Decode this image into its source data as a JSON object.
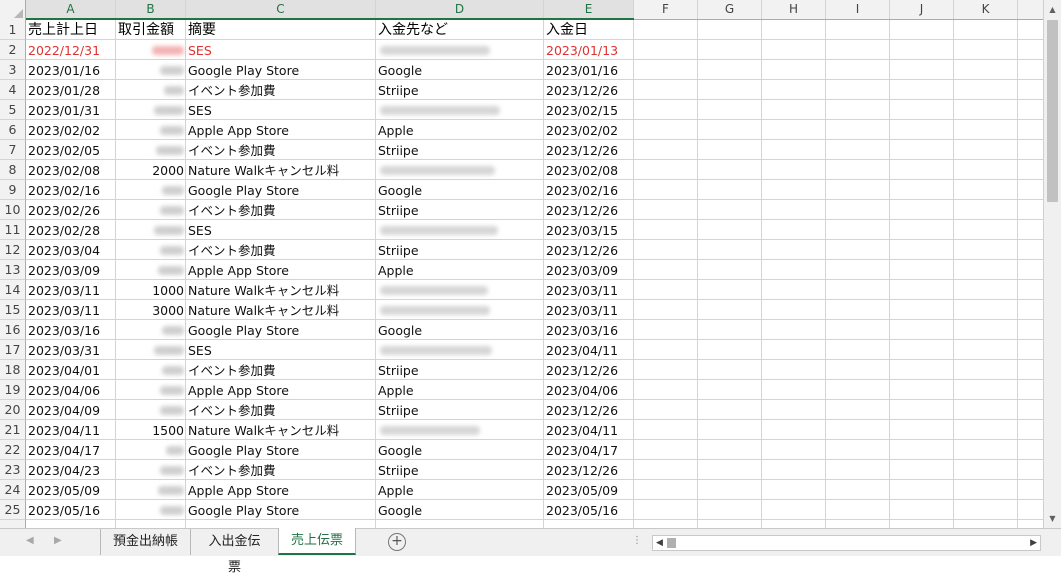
{
  "columns": [
    "A",
    "B",
    "C",
    "D",
    "E",
    "F",
    "G",
    "H",
    "I",
    "J",
    "K"
  ],
  "selected_columns": [
    "A",
    "B",
    "C",
    "D",
    "E"
  ],
  "header_row": {
    "row_number": "1",
    "a": "売上計上日",
    "b": "取引金額",
    "c": "摘要",
    "d": "入金先など",
    "e": "入金日"
  },
  "rows": [
    {
      "n": "2",
      "a": "2022/12/31",
      "b": "",
      "c": "SES",
      "d": "",
      "e": "2023/01/13",
      "red": true,
      "b_blur": true,
      "d_blur": true
    },
    {
      "n": "3",
      "a": "2023/01/16",
      "b": "",
      "c": "Google Play Store",
      "d": "Google",
      "e": "2023/01/16",
      "b_blur": true
    },
    {
      "n": "4",
      "a": "2023/01/28",
      "b": "",
      "c": "イベント参加費",
      "d": "Striipe",
      "e": "2023/12/26",
      "b_blur": true
    },
    {
      "n": "5",
      "a": "2023/01/31",
      "b": "",
      "c": "SES",
      "d": "",
      "e": "2023/02/15",
      "b_blur": true,
      "d_blur": true
    },
    {
      "n": "6",
      "a": "2023/02/02",
      "b": "",
      "c": "Apple App Store",
      "d": "Apple",
      "e": "2023/02/02",
      "b_blur": true
    },
    {
      "n": "7",
      "a": "2023/02/05",
      "b": "",
      "c": "イベント参加費",
      "d": "Striipe",
      "e": "2023/12/26",
      "b_blur": true
    },
    {
      "n": "8",
      "a": "2023/02/08",
      "b": "2000",
      "c": "Nature Walkキャンセル料",
      "d": "",
      "e": "2023/02/08",
      "d_blur": true
    },
    {
      "n": "9",
      "a": "2023/02/16",
      "b": "",
      "c": "Google Play Store",
      "d": "Google",
      "e": "2023/02/16",
      "b_blur": true
    },
    {
      "n": "10",
      "a": "2023/02/26",
      "b": "",
      "c": "イベント参加費",
      "d": "Striipe",
      "e": "2023/12/26",
      "b_blur": true
    },
    {
      "n": "11",
      "a": "2023/02/28",
      "b": "",
      "c": "SES",
      "d": "",
      "e": "2023/03/15",
      "b_blur": true,
      "d_blur": true
    },
    {
      "n": "12",
      "a": "2023/03/04",
      "b": "",
      "c": "イベント参加費",
      "d": "Striipe",
      "e": "2023/12/26",
      "b_blur": true
    },
    {
      "n": "13",
      "a": "2023/03/09",
      "b": "",
      "c": "Apple App Store",
      "d": "Apple",
      "e": "2023/03/09",
      "b_blur": true
    },
    {
      "n": "14",
      "a": "2023/03/11",
      "b": "1000",
      "c": "Nature Walkキャンセル料",
      "d": "",
      "e": "2023/03/11",
      "d_blur": true
    },
    {
      "n": "15",
      "a": "2023/03/11",
      "b": "3000",
      "c": "Nature Walkキャンセル料",
      "d": "",
      "e": "2023/03/11",
      "d_blur": true
    },
    {
      "n": "16",
      "a": "2023/03/16",
      "b": "",
      "c": "Google Play Store",
      "d": "Google",
      "e": "2023/03/16",
      "b_blur": true
    },
    {
      "n": "17",
      "a": "2023/03/31",
      "b": "",
      "c": "SES",
      "d": "",
      "e": "2023/04/11",
      "b_blur": true,
      "d_blur": true
    },
    {
      "n": "18",
      "a": "2023/04/01",
      "b": "",
      "c": "イベント参加費",
      "d": "Striipe",
      "e": "2023/12/26",
      "b_blur": true
    },
    {
      "n": "19",
      "a": "2023/04/06",
      "b": "",
      "c": "Apple App Store",
      "d": "Apple",
      "e": "2023/04/06",
      "b_blur": true
    },
    {
      "n": "20",
      "a": "2023/04/09",
      "b": "",
      "c": "イベント参加費",
      "d": "Striipe",
      "e": "2023/12/26",
      "b_blur": true
    },
    {
      "n": "21",
      "a": "2023/04/11",
      "b": "1500",
      "c": "Nature Walkキャンセル料",
      "d": "",
      "e": "2023/04/11",
      "d_blur": true
    },
    {
      "n": "22",
      "a": "2023/04/17",
      "b": "",
      "c": "Google Play Store",
      "d": "Google",
      "e": "2023/04/17",
      "b_blur": true
    },
    {
      "n": "23",
      "a": "2023/04/23",
      "b": "",
      "c": "イベント参加費",
      "d": "Striipe",
      "e": "2023/12/26",
      "b_blur": true
    },
    {
      "n": "24",
      "a": "2023/05/09",
      "b": "",
      "c": "Apple App Store",
      "d": "Apple",
      "e": "2023/05/09",
      "b_blur": true
    },
    {
      "n": "25",
      "a": "2023/05/16",
      "b": "",
      "c": "Google Play Store",
      "d": "Google",
      "e": "2023/05/16",
      "b_blur": true
    }
  ],
  "sheet_tabs": [
    {
      "label": "預金出納帳",
      "active": false
    },
    {
      "label": "入出金伝票",
      "active": false
    },
    {
      "label": "売上伝票",
      "active": true
    }
  ],
  "icons": {
    "nav_prev": "nav-prev-icon",
    "nav_next": "nav-next-icon",
    "add_sheet": "plus-circle-icon",
    "scroll_up": "scroll-up-icon",
    "scroll_down": "scroll-down-icon",
    "scroll_left": "scroll-left-icon",
    "scroll_right": "scroll-right-icon"
  },
  "colors": {
    "accent": "#217346",
    "red_text": "#e03131"
  }
}
